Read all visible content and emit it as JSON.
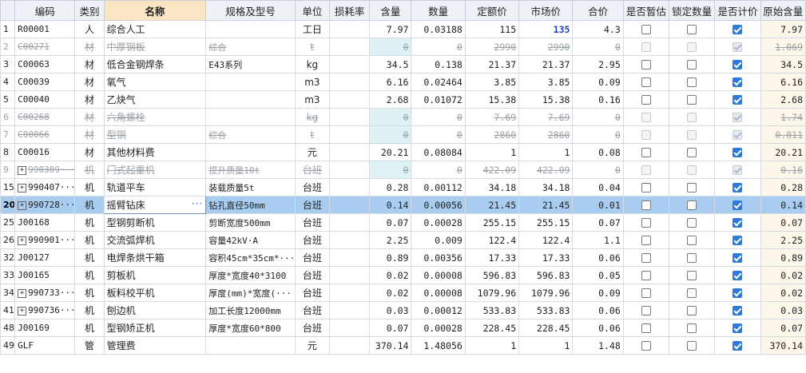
{
  "headers": {
    "rownum": "",
    "code": "编码",
    "type": "类别",
    "name": "名称",
    "spec": "规格及型号",
    "unit": "单位",
    "loss": "损耗率",
    "content": "含量",
    "qty": "数量",
    "quota_price": "定额价",
    "market_price": "市场价",
    "total": "合价",
    "provisional": "是否暂估",
    "lock_qty": "锁定数量",
    "priced": "是否计价",
    "orig_content": "原始含量"
  },
  "rows": [
    {
      "n": "1",
      "code": "R00001",
      "type": "人",
      "name": "综合人工",
      "spec": "",
      "unit": "工日",
      "loss": "",
      "content": "7.97",
      "qty": "0.03188",
      "quota": "115",
      "market": "135",
      "total": "4.3",
      "prov": false,
      "lock": false,
      "priced": true,
      "orig": "7.97"
    },
    {
      "n": "2",
      "code": "C00271",
      "type": "材",
      "name": "中厚钢板",
      "spec": "综合",
      "unit": "t",
      "loss": "",
      "content": "0",
      "qty": "0",
      "quota": "2990",
      "market": "2990",
      "total": "0",
      "prov": false,
      "lock": false,
      "priced": true,
      "orig": "1.069"
    },
    {
      "n": "3",
      "code": "C00063",
      "type": "材",
      "name": "低合金钢焊条",
      "spec": "E43系列",
      "unit": "kg",
      "loss": "",
      "content": "34.5",
      "qty": "0.138",
      "quota": "21.37",
      "market": "21.37",
      "total": "2.95",
      "prov": false,
      "lock": false,
      "priced": true,
      "orig": "34.5"
    },
    {
      "n": "4",
      "code": "C00039",
      "type": "材",
      "name": "氧气",
      "spec": "",
      "unit": "m3",
      "loss": "",
      "content": "6.16",
      "qty": "0.02464",
      "quota": "3.85",
      "market": "3.85",
      "total": "0.09",
      "prov": false,
      "lock": false,
      "priced": true,
      "orig": "6.16"
    },
    {
      "n": "5",
      "code": "C00040",
      "type": "材",
      "name": "乙炔气",
      "spec": "",
      "unit": "m3",
      "loss": "",
      "content": "2.68",
      "qty": "0.01072",
      "quota": "15.38",
      "market": "15.38",
      "total": "0.16",
      "prov": false,
      "lock": false,
      "priced": true,
      "orig": "2.68"
    },
    {
      "n": "6",
      "code": "C00268",
      "type": "材",
      "name": "六角螺栓",
      "spec": "",
      "unit": "kg",
      "loss": "",
      "content": "0",
      "qty": "0",
      "quota": "7.69",
      "market": "7.69",
      "total": "0",
      "prov": false,
      "lock": false,
      "priced": true,
      "orig": "1.74"
    },
    {
      "n": "7",
      "code": "C00066",
      "type": "材",
      "name": "型钢",
      "spec": "综合",
      "unit": "t",
      "loss": "",
      "content": "0",
      "qty": "0",
      "quota": "2860",
      "market": "2860",
      "total": "0",
      "prov": false,
      "lock": false,
      "priced": true,
      "orig": "0.011"
    },
    {
      "n": "8",
      "code": "C00016",
      "type": "材",
      "name": "其他材料费",
      "spec": "",
      "unit": "元",
      "loss": "",
      "content": "20.21",
      "qty": "0.08084",
      "quota": "1",
      "market": "1",
      "total": "0.08",
      "prov": false,
      "lock": false,
      "priced": true,
      "orig": "20.21"
    },
    {
      "n": "9",
      "code": "990309···",
      "type": "机",
      "name": "门式起重机",
      "spec": "提升质量10t",
      "unit": "台班",
      "loss": "",
      "content": "0",
      "qty": "0",
      "quota": "422.09",
      "market": "422.09",
      "total": "0",
      "prov": false,
      "lock": false,
      "priced": true,
      "orig": "0.16"
    },
    {
      "n": "15",
      "code": "990407···",
      "type": "机",
      "name": "轨道平车",
      "spec": "装载质量5t",
      "unit": "台班",
      "loss": "",
      "content": "0.28",
      "qty": "0.00112",
      "quota": "34.18",
      "market": "34.18",
      "total": "0.04",
      "prov": false,
      "lock": false,
      "priced": true,
      "orig": "0.28"
    },
    {
      "n": "20",
      "code": "990728···",
      "type": "机",
      "name": "摇臂钻床",
      "spec": "钻孔直径50mm",
      "unit": "台班",
      "loss": "",
      "content": "0.14",
      "qty": "0.00056",
      "quota": "21.45",
      "market": "21.45",
      "total": "0.01",
      "prov": false,
      "lock": false,
      "priced": true,
      "orig": "0.14"
    },
    {
      "n": "25",
      "code": "J00168",
      "type": "机",
      "name": "型钢剪断机",
      "spec": "剪断宽度500mm",
      "unit": "台班",
      "loss": "",
      "content": "0.07",
      "qty": "0.00028",
      "quota": "255.15",
      "market": "255.15",
      "total": "0.07",
      "prov": false,
      "lock": false,
      "priced": true,
      "orig": "0.07"
    },
    {
      "n": "26",
      "code": "990901···",
      "type": "机",
      "name": "交流弧焊机",
      "spec": "容量42kV·A",
      "unit": "台班",
      "loss": "",
      "content": "2.25",
      "qty": "0.009",
      "quota": "122.4",
      "market": "122.4",
      "total": "1.1",
      "prov": false,
      "lock": false,
      "priced": true,
      "orig": "2.25"
    },
    {
      "n": "32",
      "code": "J00127",
      "type": "机",
      "name": "电焊条烘干箱",
      "spec": "容积45cm*35cm*···",
      "unit": "台班",
      "loss": "",
      "content": "0.89",
      "qty": "0.00356",
      "quota": "17.33",
      "market": "17.33",
      "total": "0.06",
      "prov": false,
      "lock": false,
      "priced": true,
      "orig": "0.89"
    },
    {
      "n": "33",
      "code": "J00165",
      "type": "机",
      "name": "剪板机",
      "spec": "厚度*宽度40*3100",
      "unit": "台班",
      "loss": "",
      "content": "0.02",
      "qty": "0.00008",
      "quota": "596.83",
      "market": "596.83",
      "total": "0.05",
      "prov": false,
      "lock": false,
      "priced": true,
      "orig": "0.02"
    },
    {
      "n": "34",
      "code": "990733···",
      "type": "机",
      "name": "板料校平机",
      "spec": "厚度(mm)*宽度(···",
      "unit": "台班",
      "loss": "",
      "content": "0.02",
      "qty": "0.00008",
      "quota": "1079.96",
      "market": "1079.96",
      "total": "0.09",
      "prov": false,
      "lock": false,
      "priced": true,
      "orig": "0.02"
    },
    {
      "n": "41",
      "code": "990736···",
      "type": "机",
      "name": "刨边机",
      "spec": "加工长度12000mm",
      "unit": "台班",
      "loss": "",
      "content": "0.03",
      "qty": "0.00012",
      "quota": "533.83",
      "market": "533.83",
      "total": "0.06",
      "prov": false,
      "lock": false,
      "priced": true,
      "orig": "0.03"
    },
    {
      "n": "48",
      "code": "J00169",
      "type": "机",
      "name": "型钢矫正机",
      "spec": "厚度*宽度60*800",
      "unit": "台班",
      "loss": "",
      "content": "0.07",
      "qty": "0.00028",
      "quota": "228.45",
      "market": "228.45",
      "total": "0.06",
      "prov": false,
      "lock": false,
      "priced": true,
      "orig": "0.07"
    },
    {
      "n": "49",
      "code": "GLF",
      "type": "管",
      "name": "管理费",
      "spec": "",
      "unit": "元",
      "loss": "",
      "content": "370.14",
      "qty": "1.48056",
      "quota": "1",
      "market": "1",
      "total": "1.48",
      "prov": false,
      "lock": false,
      "priced": true,
      "orig": "370.14"
    }
  ]
}
